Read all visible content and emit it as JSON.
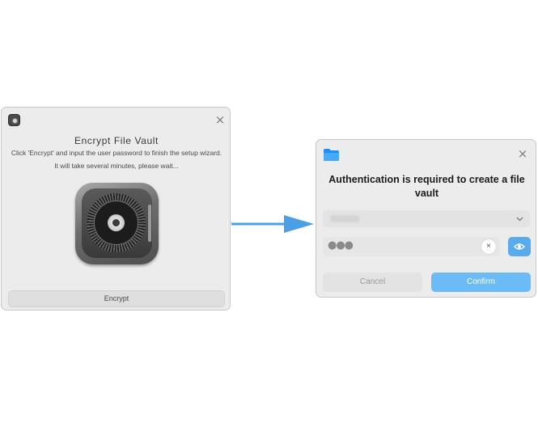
{
  "encrypt_dialog": {
    "title": "Encrypt File Vault",
    "description_line1": "Click 'Encrypt' and input the user password to finish the setup wizard.",
    "description_line2": "It will take several minutes, please wait...",
    "encrypt_label": "Encrypt",
    "close_glyph": "×",
    "icons": [
      "app-icon",
      "close-icon",
      "vault-icon"
    ]
  },
  "auth_dialog": {
    "title": "Authentication is required to create a file vault",
    "password_mask": "●●●",
    "clear_glyph": "×",
    "close_glyph": "×",
    "cancel_label": "Cancel",
    "confirm_label": "Confirm",
    "icons": [
      "folder-icon",
      "close-icon",
      "chevron-down-icon",
      "eye-icon"
    ]
  },
  "colors": {
    "accent": "#6bbbf6",
    "eye_button": "#5aabeb",
    "arrow": "#4a9fe6",
    "dialog_bg": "#ececec"
  }
}
